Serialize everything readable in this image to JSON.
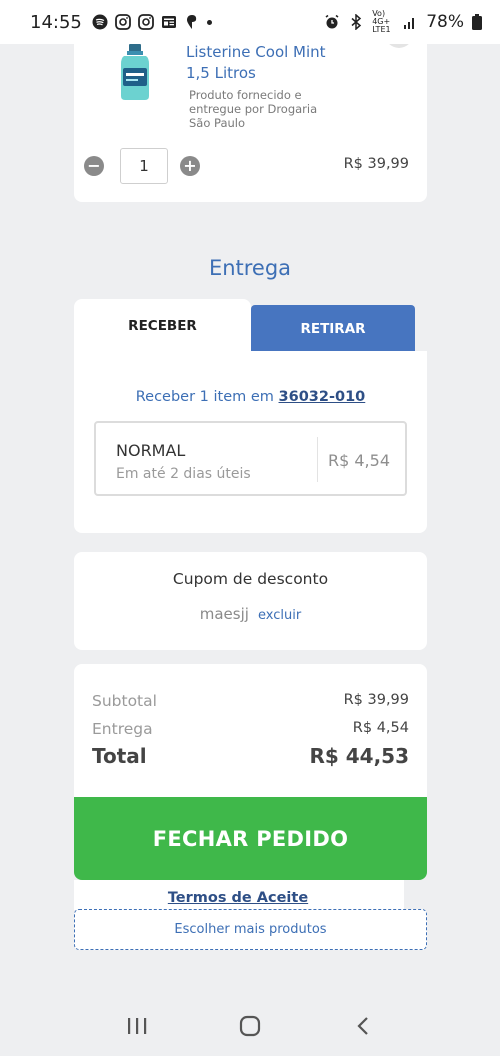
{
  "status_bar": {
    "time": "14:55",
    "battery": "78%",
    "network": "Vo) 4G+ LTE1"
  },
  "product": {
    "name": "Listerine Cool Mint 1,5 Litros",
    "note": "Produto fornecido e entregue por Drogaria São Paulo",
    "quantity": "1",
    "price": "R$ 39,99",
    "minus": "−",
    "plus": "+"
  },
  "delivery": {
    "title": "Entrega",
    "tabs": {
      "receive": "RECEBER",
      "pickup": "RETIRAR"
    },
    "deliver_prefix": "Receber 1 item em",
    "cep": "36032-010",
    "option_name": "NORMAL",
    "option_eta": "Em até 2 dias úteis",
    "option_price": "R$ 4,54"
  },
  "coupon": {
    "title": "Cupom de desconto",
    "code": "maesjj",
    "remove": "excluir"
  },
  "summary": {
    "subtotal_label": "Subtotal",
    "subtotal_value": "R$ 39,99",
    "delivery_label": "Entrega",
    "delivery_value": "R$ 4,54",
    "total_label": "Total",
    "total_value": "R$ 44,53"
  },
  "checkout_label": "FECHAR PEDIDO",
  "terms_label": "Termos de Aceite",
  "more_products_label": "Escolher mais produtos",
  "colors": {
    "accent_blue": "#3d6fb5",
    "tab_blue": "#4775c0",
    "checkout_green": "#3fb84a",
    "background": "#eeeff1"
  }
}
